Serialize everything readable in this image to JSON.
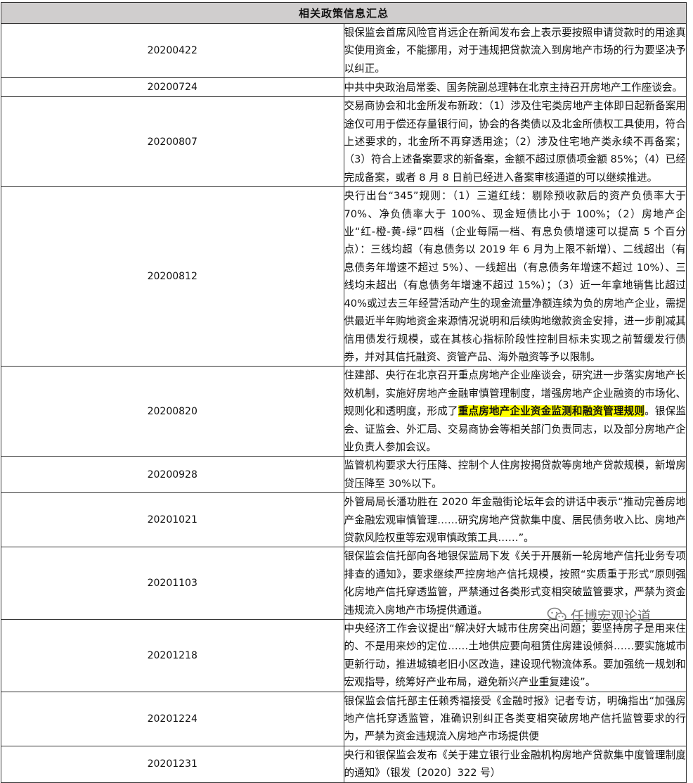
{
  "table": {
    "title": "相关政策信息汇总",
    "rows": [
      {
        "date": "20200422",
        "pre": "银保监会首席风险官肖远企在新闻发布会上表示要按照申请贷款时的用途真实使用资金，不能挪用，对于违规把贷款流入到房地产市场的行为要坚决予以纠正。",
        "hl": "",
        "post": ""
      },
      {
        "date": "20200724",
        "pre": "中共中央政治局常委、国务院副总理韩在北京主持召开房地产工作座谈会。",
        "hl": "",
        "post": ""
      },
      {
        "date": "20200807",
        "pre": "交易商协会和北金所发布新政：（1）涉及住宅类房地产主体即日起新备案用途仅可用于偿还存量银行间，协会的各类债以及北金所债权工具使用，符合上述要求的，北金所不再穿透用途；（2）涉及住宅地产类永续不再备案；（3）符合上述备案要求的新备案，金额不超过原债项金额 85%；（4）已经完成备案，或者 8 月 8 日前已经进入备案审核通道的可以继续推进。",
        "hl": "",
        "post": ""
      },
      {
        "date": "20200812",
        "pre": "央行出台“345”规则：（1）三道红线：剔除预收款后的资产负债率大于 70%、净负债率大于 100%、现金短债比小于 100%；（2）房地产企业“红-橙-黄-绿”四档（企业每隔一档、有息负债增速可以提高 5 个百分点）：三线均超（有息债务以 2019 年 6 月为上限不新增）、二线超出（有息债务年增速不超过 5%）、一线超出（有息债务年增速不超过 10%）、三线均未超出（有息债务年增速不超过 15%）；（3）近一年拿地销售比超过 40%或过去三年经营活动产生的现金流量净额连续为负的房地产企业，需提供最近半年购地资金来源情况说明和后续购地缴款资金安排，进一步削减其信用债发行规模，或在其核心指标阶段性控制目标未实现之前暂缓发行债券，并对其信托融资、资管产品、海外融资等予以限制。",
        "hl": "",
        "post": ""
      },
      {
        "date": "20200820",
        "pre": "住建部、央行在北京召开重点房地产企业座谈会，研究进一步落实房地产长效机制，实施好房地产金融审慎管理制度，增强房地产企业融资的市场化、规则化和透明度，形成了",
        "hl": "重点房地产企业资金监测和融资管理规则",
        "post": "。银保监会、证监会、外汇局、交易商协会等相关部门负责同志，以及部分房地产企业负责人参加会议。"
      },
      {
        "date": "20200928",
        "pre": "监管机构要求大行压降、控制个人住房按揭贷款等房地产贷款规模，新增房贷压降至 30%以下。",
        "hl": "",
        "post": ""
      },
      {
        "date": "20201021",
        "pre": "外管局局长潘功胜在 2020 年金融街论坛年会的讲话中表示“推动完善房地产金融宏观审慎管理……研究房地产贷款集中度、居民债务收入比、房地产贷款风险权重等宏观审慎政策工具……”。",
        "hl": "",
        "post": ""
      },
      {
        "date": "20201103",
        "pre": "银保监会信托部向各地银保监局下发《关于开展新一轮房地产信托业务专项排查的通知》，要求继续严控房地产信托规模，按照“实质重于形式”原则强化房地产信托穿透监管，严禁通过各类形式变相突破监管要求，严禁为资金违规流入房地产市场提供通道。",
        "hl": "",
        "post": ""
      },
      {
        "date": "20201218",
        "pre": "中央经济工作会议提出“解决好大城市住房突出问题；要坚持房子是用来住的、不是用来炒的定位……土地供应要向租赁住房建设倾斜……要实施城市更新行动，推进城镇老旧小区改造，建设现代物流体系。要加强统一规划和宏观指导，统筹好产业布局，避免新兴产业重复建设”。",
        "hl": "",
        "post": ""
      },
      {
        "date": "20201224",
        "pre": "银保监会信托部主任赖秀福接受《金融时报》记者专访，明确指出“加强房地产信托穿透监管，准确识别纠正各类变相突破房地产信托监管要求的行为，严禁为资金违规流入房地产市场提供便",
        "hl": "",
        "post": ""
      },
      {
        "date": "20201231",
        "pre": "央行和银保监会发布《关于建立银行业金融机构房地产贷款集中度管理制度的通知》（银发〔2020〕322 号）",
        "hl": "",
        "post": ""
      }
    ]
  },
  "watermark": {
    "text": "任博宏观论道",
    "icon": "wechat-icon"
  }
}
